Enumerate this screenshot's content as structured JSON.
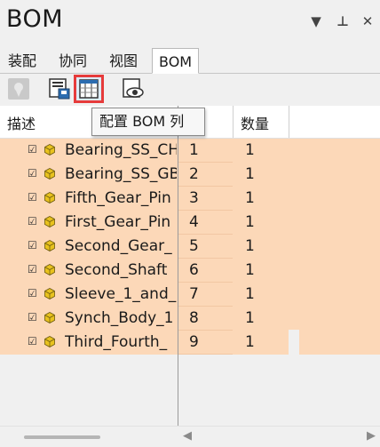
{
  "panel": {
    "title": "BOM",
    "controls": {
      "dropdown": "▼",
      "pin": "⊥",
      "close": "✕"
    }
  },
  "tabs": [
    {
      "label": "装配",
      "active": false
    },
    {
      "label": "协同",
      "active": false
    },
    {
      "label": "视图",
      "active": false
    },
    {
      "label": "BOM",
      "active": true
    }
  ],
  "toolbar": {
    "buttons": [
      {
        "icon": "visibility-filter-icon",
        "enabled": false
      },
      {
        "icon": "save-bom-icon",
        "enabled": true
      },
      {
        "icon": "configure-columns-icon",
        "enabled": true,
        "highlighted": true
      },
      {
        "icon": "preview-eye-icon",
        "enabled": true
      }
    ],
    "tooltip": "配置 BOM 列"
  },
  "grid": {
    "columns": {
      "description": "描述",
      "quantity": "数量"
    },
    "rows": [
      {
        "name": "Bearing_SS_CH",
        "number": "1",
        "qty": "1",
        "checked": true
      },
      {
        "name": "Bearing_SS_GB",
        "number": "2",
        "qty": "1",
        "checked": true
      },
      {
        "name": "Fifth_Gear_Pin",
        "number": "3",
        "qty": "1",
        "checked": true
      },
      {
        "name": "First_Gear_Pin",
        "number": "4",
        "qty": "1",
        "checked": true
      },
      {
        "name": "Second_Gear_",
        "number": "5",
        "qty": "1",
        "checked": true
      },
      {
        "name": "Second_Shaft",
        "number": "6",
        "qty": "1",
        "checked": true
      },
      {
        "name": "Sleeve_1_and_",
        "number": "7",
        "qty": "1",
        "checked": true
      },
      {
        "name": "Synch_Body_1",
        "number": "8",
        "qty": "1",
        "checked": true
      },
      {
        "name": "Third_Fourth_",
        "number": "9",
        "qty": "1",
        "checked": true
      }
    ]
  },
  "colors": {
    "row_highlight": "#fcd8b8",
    "tooltip_outline": "#e63b3b",
    "part_icon": "#e8c21e"
  }
}
